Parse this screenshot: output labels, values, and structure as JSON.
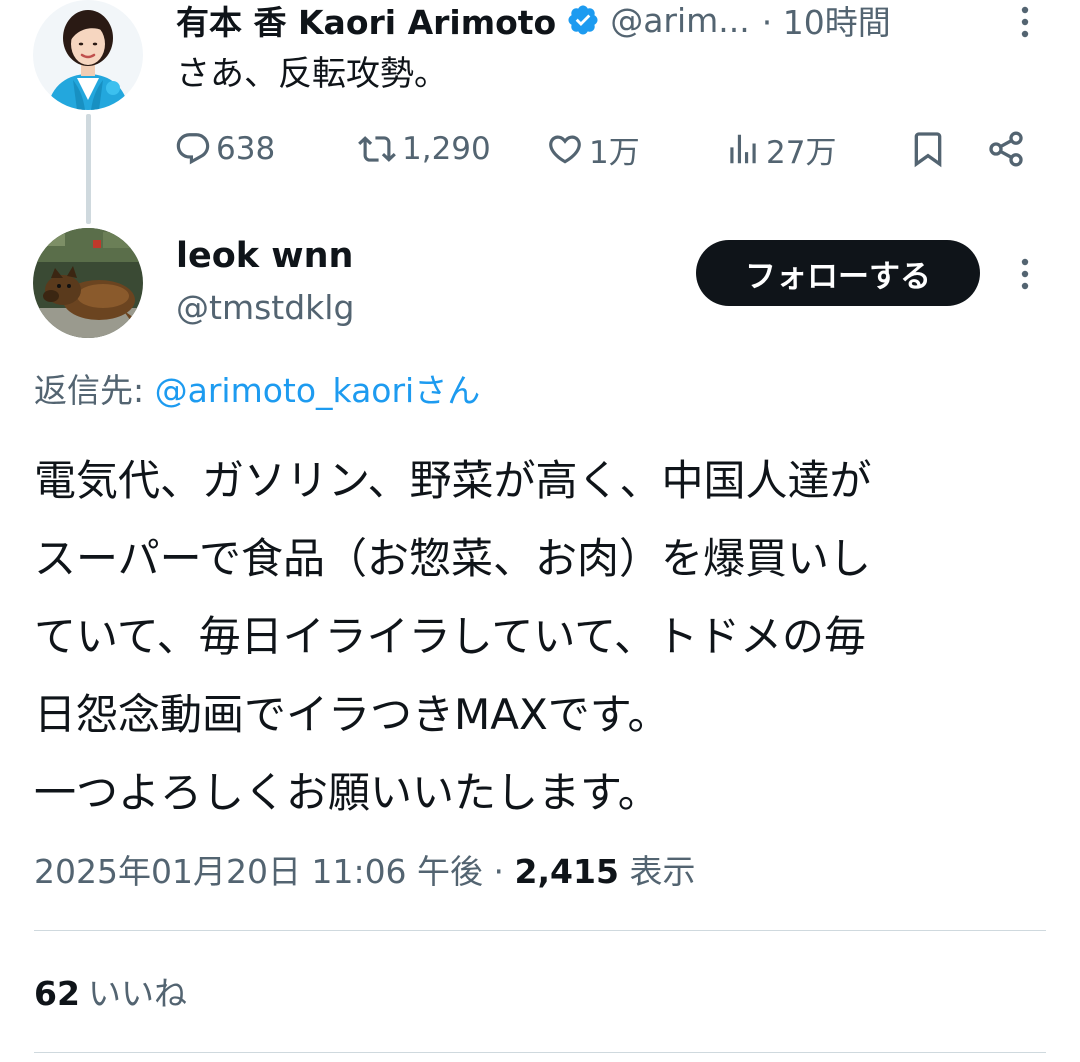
{
  "parent_tweet": {
    "author_name": "有本 香 Kaori Arimoto",
    "handle": "@arim...",
    "time": "· 10時間",
    "text": "さあ、反転攻勢。",
    "stats": {
      "replies": "638",
      "reposts": "1,290",
      "likes": "1万",
      "views": "27万"
    },
    "icons": {
      "verified": "verified-badge-icon",
      "reply": "reply-icon",
      "repost": "repost-icon",
      "like": "heart-icon",
      "views": "views-chart-icon",
      "bookmark": "bookmark-icon",
      "share": "share-icon",
      "more": "more-vertical-icon"
    }
  },
  "reply_tweet": {
    "author_name": "leok wnn",
    "handle": "@tmstdklg",
    "follow_label": "フォローする",
    "replying_prefix": "返信先: ",
    "replying_mention": "@arimoto_kaori",
    "replying_suffix": "さん",
    "body_lines": [
      "電気代、ガソリン、野菜が高く、中国人達が",
      "スーパーで食品（お惣菜、お肉）を爆買いし",
      "ていて、毎日イライラしていて、トドメの毎",
      "日怨念動画でイラつきMAXです。",
      "一つよろしくお願いいたします。"
    ],
    "timestamp": "2025年01月20日 11:06 午後",
    "separator": "·",
    "view_count": "2,415",
    "view_label": "表示",
    "like_count": "62",
    "like_label": "いいね"
  },
  "colors": {
    "text_primary": "#0f1419",
    "text_secondary": "#536471",
    "link": "#1d9bf0",
    "verified": "#1d9bf0",
    "divider": "#cfd9de",
    "follow_button_bg": "#0f1419"
  }
}
